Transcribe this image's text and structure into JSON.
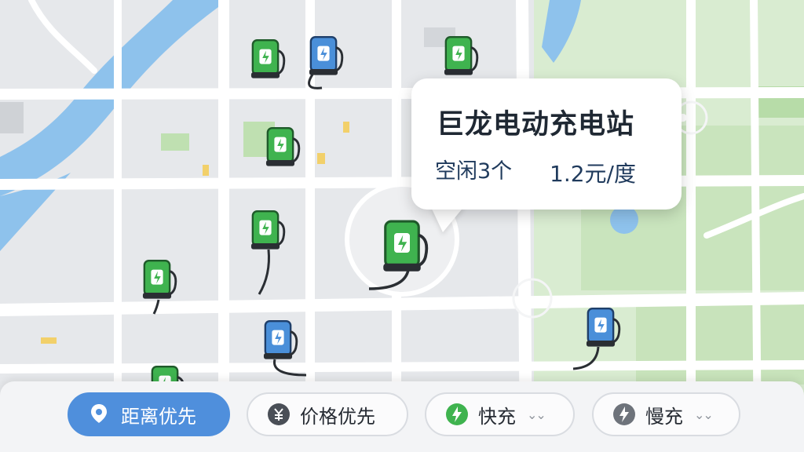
{
  "popup": {
    "station_name": "巨龙电动充电站",
    "idle_count": "空闲3个",
    "price": "1.2元/度"
  },
  "filters": {
    "distance_label": "距离优先",
    "price_label": "价格优先",
    "fast_label": "快充",
    "slow_label": "慢充",
    "fast_chevron": "⌄⌄",
    "slow_chevron": "⌄⌄"
  },
  "colors": {
    "charger_green": "#3fb34f",
    "charger_blue": "#4a8fd9",
    "river": "#8ec2ec",
    "park": "#cfe5c4",
    "accent": "#4f8fdc"
  },
  "markers": [
    {
      "type": "charger",
      "color": "green",
      "icon": "ev-charger-icon"
    },
    {
      "type": "charger",
      "color": "blue",
      "icon": "ev-charger-icon"
    }
  ]
}
